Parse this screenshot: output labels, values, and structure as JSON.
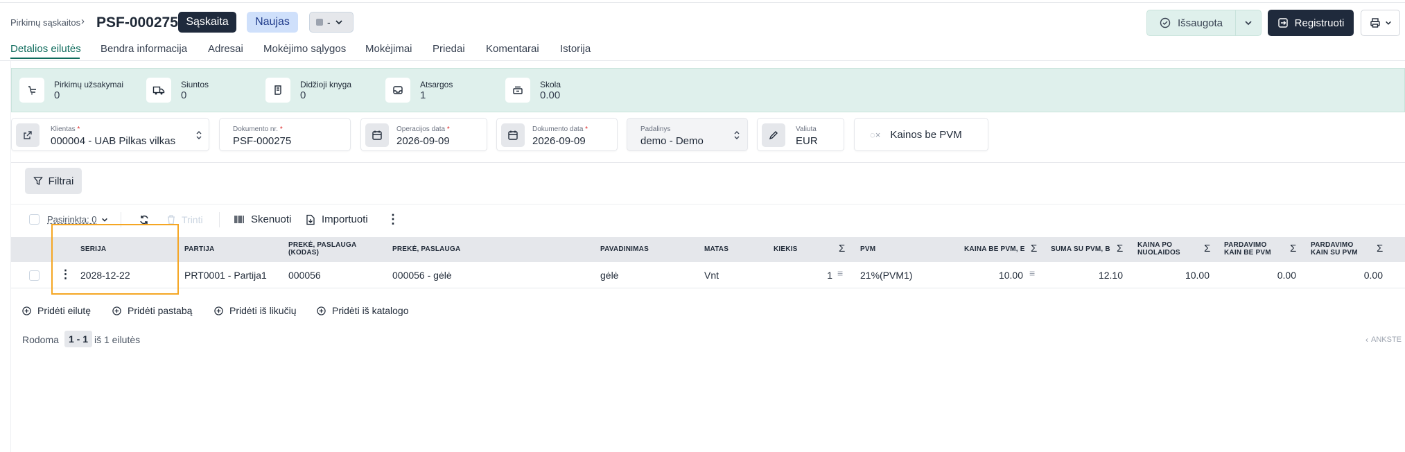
{
  "header": {
    "breadcrumb": "Pirkimų sąskaitos",
    "doc_number": "PSF-000275",
    "type_badge": "Sąskaita",
    "status_badge": "Naujas",
    "select_value": "-",
    "saved_label": "Išsaugota",
    "register_label": "Registruoti"
  },
  "tabs": [
    "Detalios eilutės",
    "Bendra informacija",
    "Adresai",
    "Mokėjimo sąlygos",
    "Mokėjimai",
    "Priedai",
    "Komentarai",
    "Istorija"
  ],
  "stats": [
    {
      "label": "Pirkimų užsakymai",
      "value": "0",
      "icon": "cart-icon"
    },
    {
      "label": "Siuntos",
      "value": "0",
      "icon": "truck-icon"
    },
    {
      "label": "Didžioji knyga",
      "value": "0",
      "icon": "ledger-icon"
    },
    {
      "label": "Atsargos",
      "value": "1",
      "icon": "inbox-icon"
    },
    {
      "label": "Skola",
      "value": "0.00",
      "icon": "debt-icon"
    }
  ],
  "fields": {
    "client": {
      "label": "Klientas",
      "value": "000004 - UAB Pilkas vilkas"
    },
    "doc_no": {
      "label": "Dokumento nr.",
      "value": "PSF-000275"
    },
    "op_date": {
      "label": "Operacijos data",
      "value": "2026-09-09"
    },
    "doc_date": {
      "label": "Dokumento data",
      "value": "2026-09-09"
    },
    "unit": {
      "label": "Padalinys",
      "value": "demo - Demo"
    },
    "currency": {
      "label": "Valiuta",
      "value": "EUR"
    },
    "prices_toggle": "Kainos be PVM"
  },
  "filters_label": "Filtrai",
  "toolbar": {
    "selected": "Pasirinkta: 0",
    "delete": "Trinti",
    "scan": "Skenuoti",
    "import": "Importuoti"
  },
  "table": {
    "headers": [
      "SERIJA",
      "PARTIJA",
      "PREKĖ, PASLAUGA (KODAS)",
      "PREKĖ, PASLAUGA",
      "PAVADINIMAS",
      "MATAS",
      "KIEKIS",
      "PVM",
      "KAINA BE PVM, E",
      "SUMA SU PVM, B",
      "KAINA PO NUOLAIDOS",
      "PARDAVIMO KAIN BE PVM",
      "PARDAVIMO KAIN SU PVM"
    ],
    "row": [
      "2028-12-22",
      "PRT0001 - Partija1",
      "000056",
      "000056 - gėlė",
      "gėlė",
      "Vnt",
      "1",
      "21%(PVM1)",
      "10.00",
      "12.10",
      "10.00",
      "0.00",
      "0.00"
    ]
  },
  "add_actions": [
    "Pridėti eilutę",
    "Pridėti pastabą",
    "Pridėti iš likučių",
    "Pridėti iš katalogo"
  ],
  "pagination": {
    "showing": "Rodoma",
    "range": "1 - 1",
    "of": "iš 1 eilutės",
    "prev": "ANKSTE"
  },
  "colors": {
    "accent": "#0e6b5c",
    "banner": "#dff0ec",
    "dark_button": "#1f2a3c",
    "highlight": "#f5a623"
  }
}
